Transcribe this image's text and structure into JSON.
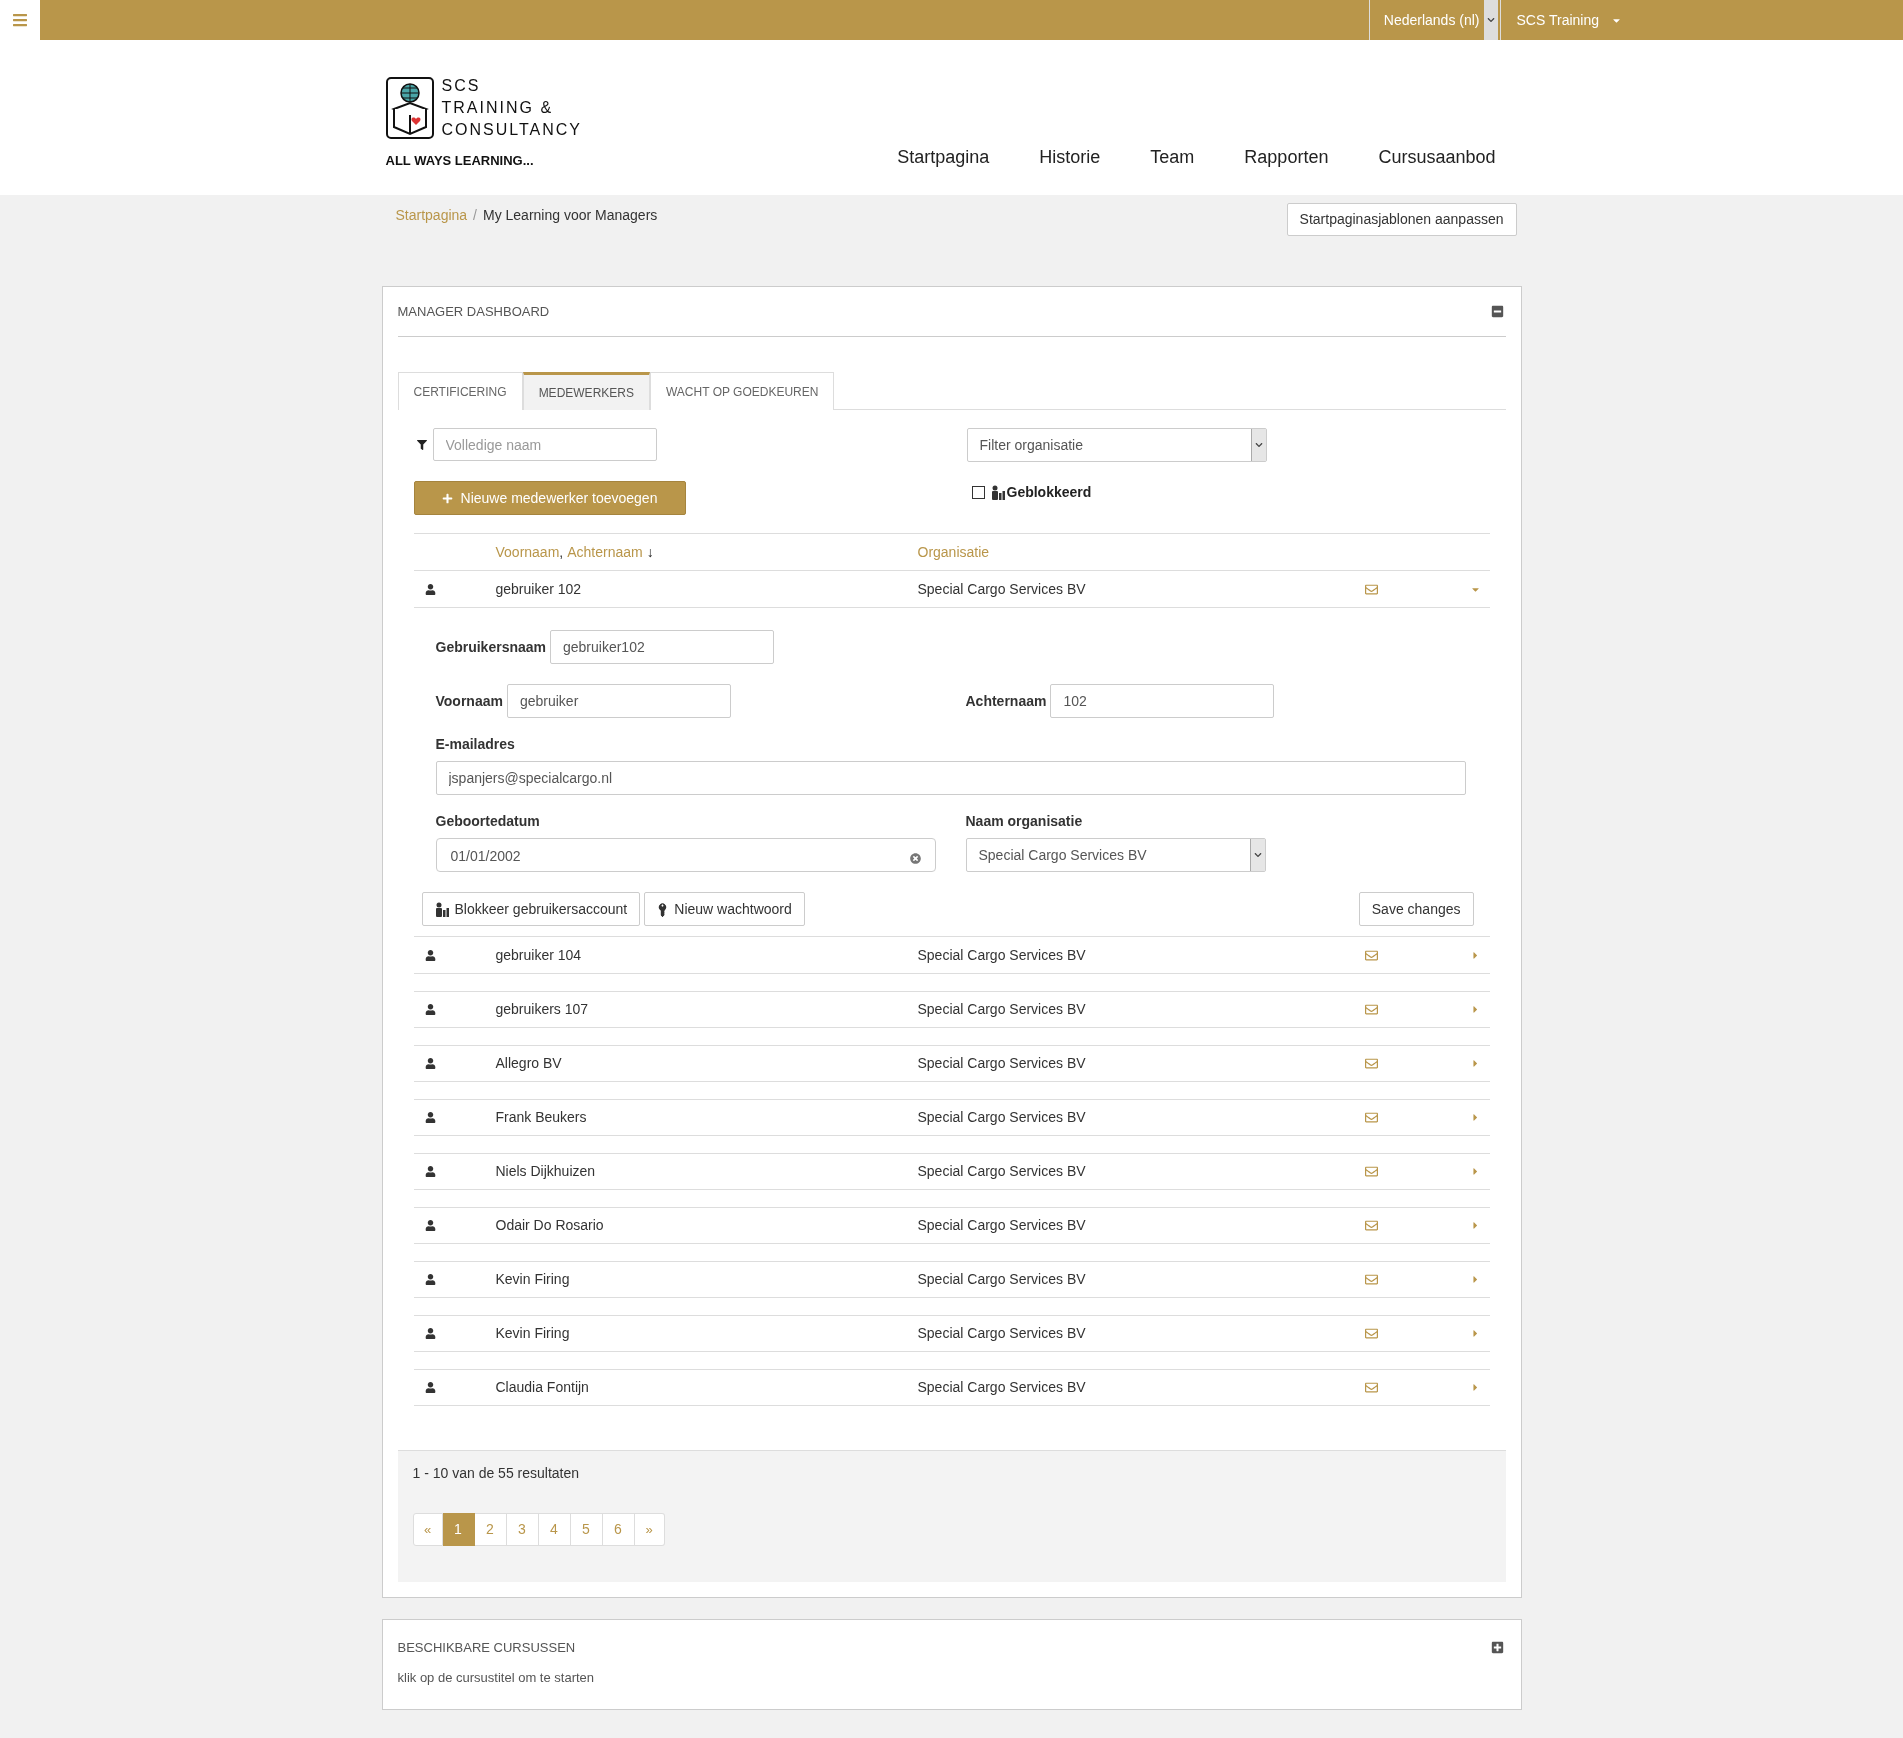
{
  "top_bar": {
    "language": "Nederlands (nl)",
    "user": "SCS Training"
  },
  "logo": {
    "lines": [
      "SCS",
      "TRAINING &",
      "CONSULTANCY"
    ],
    "tagline": "ALL WAYS LEARNING..."
  },
  "nav": [
    "Startpagina",
    "Historie",
    "Team",
    "Rapporten",
    "Cursusaanbod"
  ],
  "breadcrumb": {
    "separator": "/",
    "items": [
      {
        "label": "Startpagina",
        "link": true
      },
      {
        "label": "My Learning voor Managers",
        "link": false
      }
    ]
  },
  "customize_button": "Startpaginasjablonen aanpassen",
  "dashboard": {
    "title": "MANAGER DASHBOARD",
    "collapsed": false,
    "tabs": [
      {
        "label": "CERTIFICERING",
        "selected": false
      },
      {
        "label": "MEDEWERKERS",
        "selected": true
      },
      {
        "label": "WACHT OP GOEDKEUREN",
        "selected": false
      }
    ],
    "name_filter": {
      "placeholder": "Volledige naam"
    },
    "organisation_filter": {
      "placeholder": "Filter organisatie"
    },
    "blocked_filter": {
      "label": "Geblokkeerd",
      "checked": false
    },
    "add_button": "Nieuwe medewerker toevoegen",
    "columns": {
      "first_name": "Voornaam",
      "separator": ",",
      "last_name": "Achternaam",
      "sort_arrow": "↓",
      "organisation": "Organisatie"
    },
    "rows": [
      {
        "name": "gebruiker 102",
        "organisation": "Special Cargo Services BV",
        "expanded": true
      },
      {
        "name": "gebruiker 104",
        "organisation": "Special Cargo Services BV",
        "expanded": false
      },
      {
        "name": "gebruikers 107",
        "organisation": "Special Cargo Services BV",
        "expanded": false
      },
      {
        "name": "Allegro BV",
        "organisation": "Special Cargo Services BV",
        "expanded": false
      },
      {
        "name": "Frank Beukers",
        "organisation": "Special Cargo Services BV",
        "expanded": false
      },
      {
        "name": "Niels Dijkhuizen",
        "organisation": "Special Cargo Services BV",
        "expanded": false
      },
      {
        "name": "Odair Do Rosario",
        "organisation": "Special Cargo Services BV",
        "expanded": false
      },
      {
        "name": "Kevin Firing",
        "organisation": "Special Cargo Services BV",
        "expanded": false
      },
      {
        "name": "Kevin Firing",
        "organisation": "Special Cargo Services BV",
        "expanded": false
      },
      {
        "name": "Claudia Fontijn",
        "organisation": "Special Cargo Services BV",
        "expanded": false
      }
    ],
    "detail": {
      "username": {
        "label": "Gebruikersnaam",
        "value": "gebruiker102"
      },
      "first_name": {
        "label": "Voornaam",
        "value": "gebruiker"
      },
      "last_name": {
        "label": "Achternaam",
        "value": "102"
      },
      "email": {
        "label": "E-mailadres",
        "value": "jspanjers@specialcargo.nl"
      },
      "birth_date": {
        "label": "Geboortedatum",
        "value": "01/01/2002"
      },
      "organisation": {
        "label": "Naam organisatie",
        "value": "Special Cargo Services BV"
      },
      "block_button": "Blokkeer gebruikersaccount",
      "password_button": "Nieuw wachtwoord",
      "save_button": "Save changes"
    },
    "summary": "1 - 10 van de 55 resultaten",
    "pagination": {
      "prev": "«",
      "next": "»",
      "pages": [
        {
          "label": "1",
          "selected": true
        },
        {
          "label": "2",
          "selected": false
        },
        {
          "label": "3",
          "selected": false
        },
        {
          "label": "4",
          "selected": false
        },
        {
          "label": "5",
          "selected": false
        },
        {
          "label": "6",
          "selected": false
        }
      ]
    }
  },
  "courses_panel": {
    "title": "BESCHIKBARE CURSUSSEN",
    "subtitle": "klik op de cursustitel om te starten",
    "collapsed": true
  }
}
